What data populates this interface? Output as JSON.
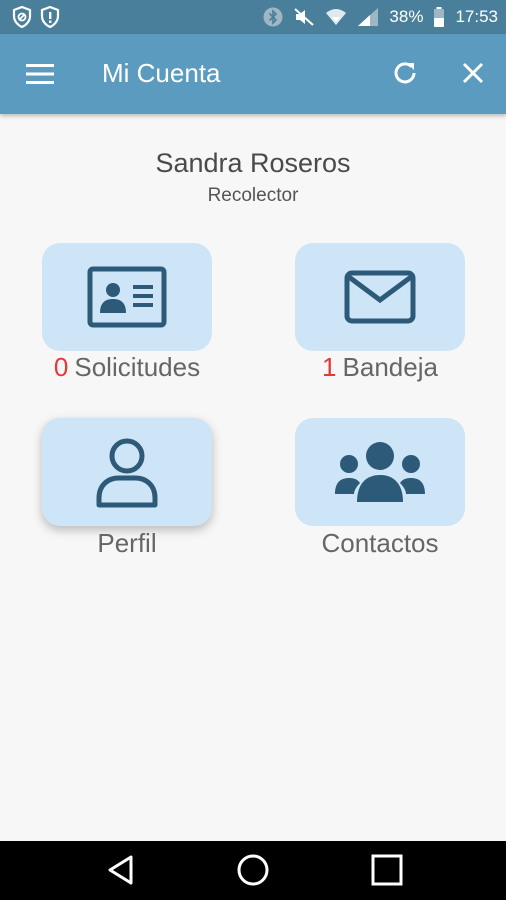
{
  "status_bar": {
    "battery": "38%",
    "time": "17:53",
    "icons": [
      "shield-icon",
      "alert-shield-icon",
      "bluetooth-icon",
      "mute-icon",
      "wifi-icon",
      "signal-icon",
      "battery-icon"
    ]
  },
  "app_bar": {
    "title": "Mi Cuenta",
    "icons": [
      "menu-icon",
      "refresh-icon",
      "close-icon"
    ]
  },
  "user": {
    "name": "Sandra Roseros",
    "role": "Recolector"
  },
  "tiles": {
    "solicitudes": {
      "count": "0",
      "label": "Solicitudes",
      "icon": "id-card-icon"
    },
    "bandeja": {
      "count": "1",
      "label": "Bandeja",
      "icon": "envelope-icon"
    },
    "perfil": {
      "label": "Perfil",
      "icon": "user-icon"
    },
    "contactos": {
      "label": "Contactos",
      "icon": "users-icon"
    }
  },
  "colors": {
    "status_bar": "#4a7f9c",
    "app_bar": "#5b9bc0",
    "tile_bg": "#cde5f6",
    "icon": "#2d5a78",
    "count": "#e53935"
  },
  "nav_bar": {
    "icons": [
      "back-icon",
      "home-icon",
      "recents-icon"
    ]
  }
}
